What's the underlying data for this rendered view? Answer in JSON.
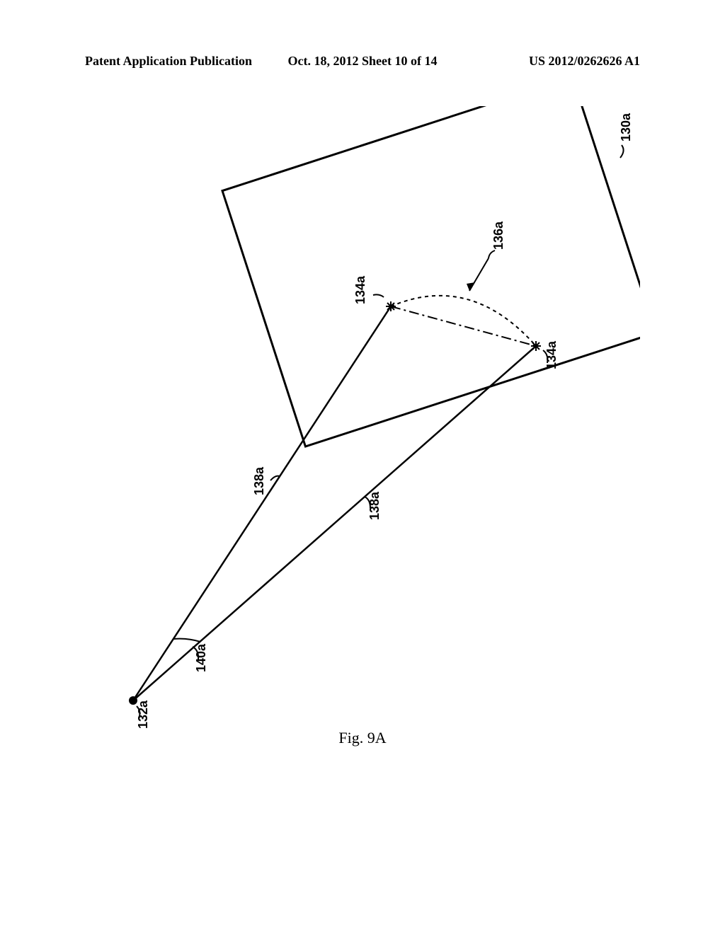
{
  "header": {
    "left": "Patent Application Publication",
    "center": "Oct. 18, 2012  Sheet 10 of 14",
    "right": "US 2012/0262626 A1"
  },
  "figure": {
    "caption": "Fig. 9A",
    "labels": {
      "l130a": "130a",
      "l134a_left": "134a",
      "l134a_right": "134a",
      "l136a": "136a",
      "l138a_left": "138a",
      "l138a_right": "138a",
      "l140a": "140a",
      "l132a": "132a"
    }
  }
}
